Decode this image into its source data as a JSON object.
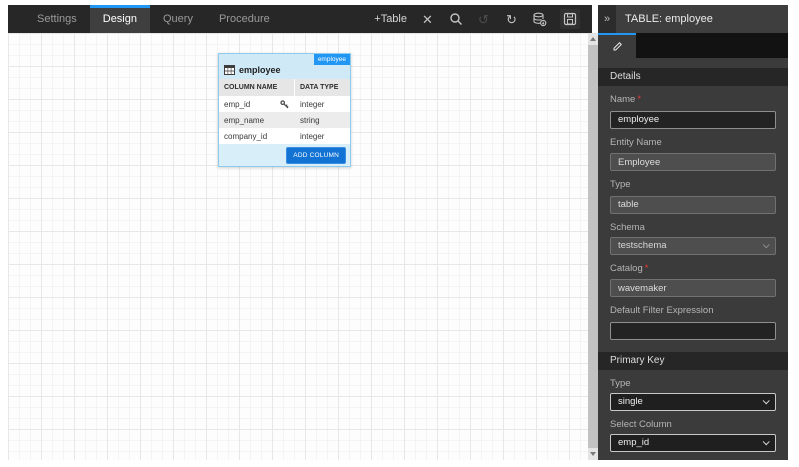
{
  "colors": {
    "accent": "#2196f3",
    "badge_blue": "#2196f3",
    "add_button_blue": "#1273d4"
  },
  "toolbar": {
    "tabs": [
      {
        "label": "Settings"
      },
      {
        "label": "Design"
      },
      {
        "label": "Query"
      },
      {
        "label": "Procedure"
      }
    ],
    "active_tab": "Design",
    "add_table_label": "+Table",
    "icons": {
      "close": "✕",
      "undo": "↺",
      "redo": "↻"
    }
  },
  "canvas": {
    "table_card": {
      "badge": "employee",
      "title": "employee",
      "header_cells": [
        "COLUMN NAME",
        "DATA TYPE"
      ],
      "rows": [
        {
          "name": "emp_id",
          "type": "integer",
          "primary_key": true
        },
        {
          "name": "emp_name",
          "type": "string",
          "primary_key": false
        },
        {
          "name": "company_id",
          "type": "integer",
          "primary_key": false
        }
      ],
      "add_column_label": "ADD COLUMN"
    }
  },
  "panel": {
    "collapse_icon": "»",
    "title": "TABLE: employee",
    "required_marker": "*",
    "details": {
      "heading": "Details",
      "name": {
        "label": "Name",
        "value": "employee"
      },
      "entity_name": {
        "label": "Entity Name",
        "value": "Employee"
      },
      "type": {
        "label": "Type",
        "value": "table"
      },
      "schema": {
        "label": "Schema",
        "value": "testschema"
      },
      "catalog": {
        "label": "Catalog",
        "value": "wavemaker"
      },
      "default_filter": {
        "label": "Default Filter Expression",
        "value": ""
      }
    },
    "primary_key": {
      "heading": "Primary Key",
      "type": {
        "label": "Type",
        "value": "single"
      },
      "select_column": {
        "label": "Select Column",
        "value": "emp_id"
      }
    }
  }
}
